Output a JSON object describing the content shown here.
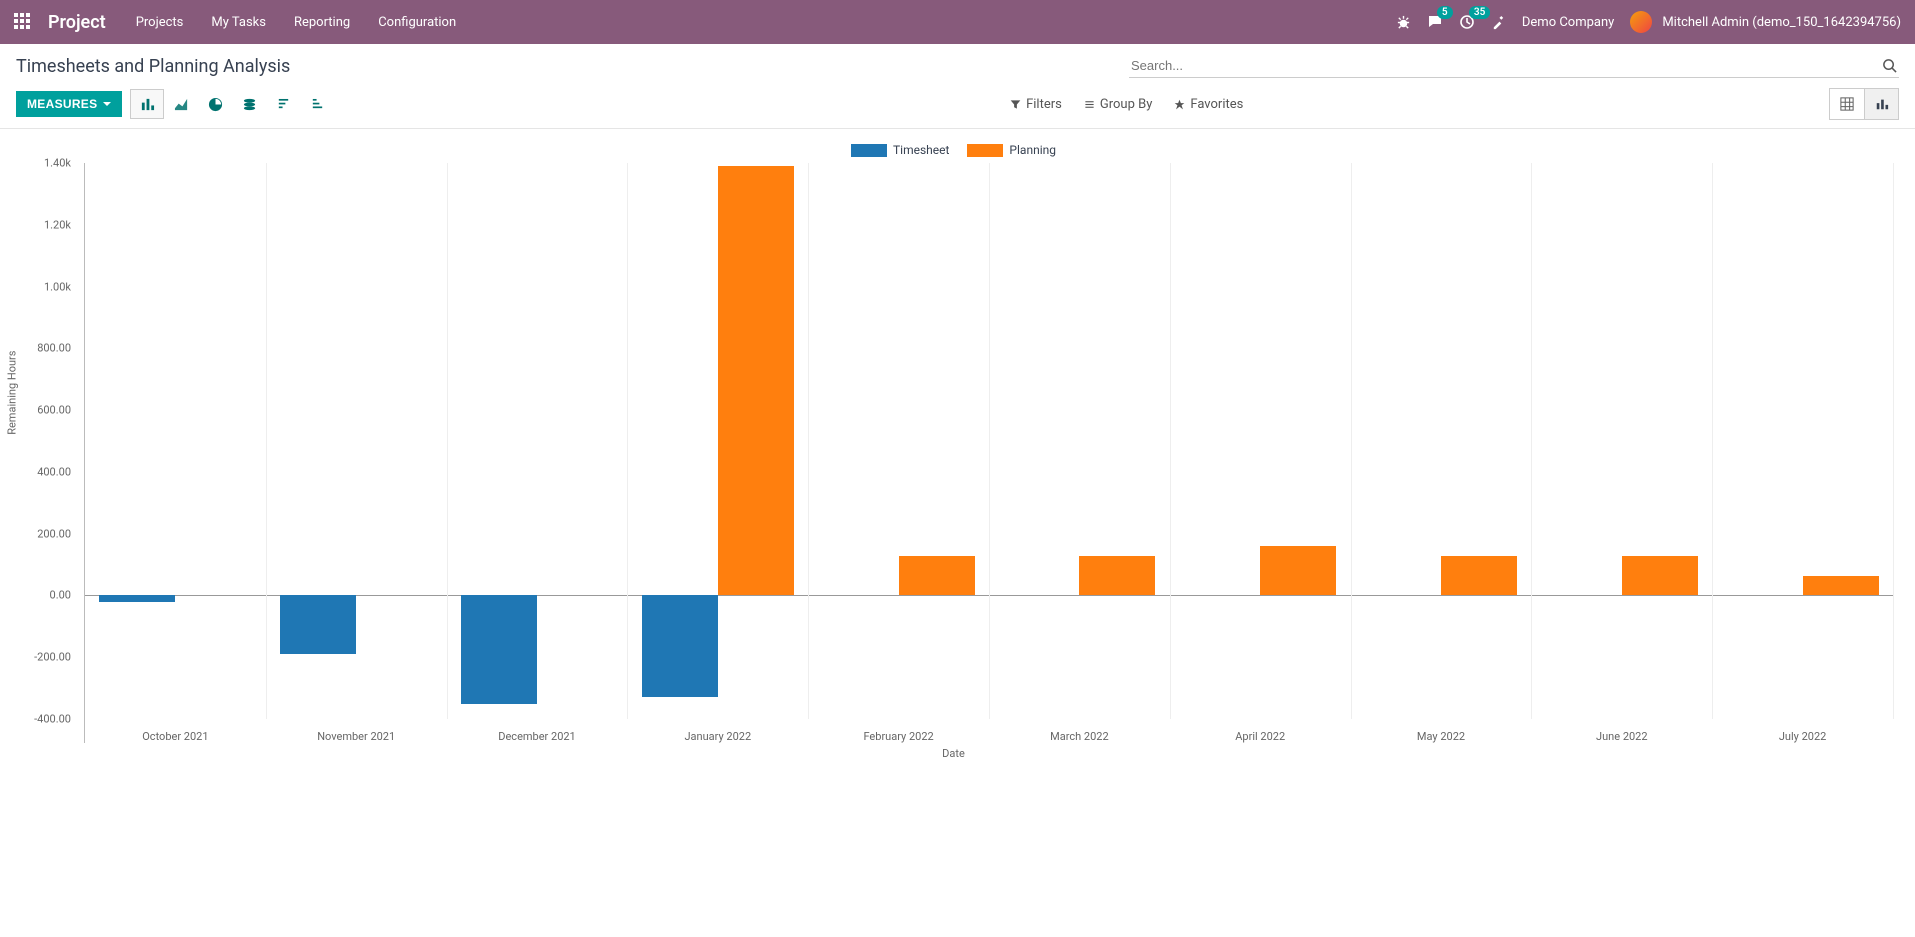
{
  "brand": "Project",
  "nav": {
    "items": [
      "Projects",
      "My Tasks",
      "Reporting",
      "Configuration"
    ]
  },
  "topbar": {
    "msg_badge": "5",
    "clock_badge": "35",
    "company": "Demo Company",
    "user": "Mitchell Admin (demo_150_1642394756)"
  },
  "breadcrumb": "Timesheets and Planning Analysis",
  "search": {
    "placeholder": "Search..."
  },
  "buttons": {
    "measures": "MEASURES"
  },
  "search_opts": {
    "filters": "Filters",
    "groupby": "Group By",
    "favorites": "Favorites"
  },
  "chart_data": {
    "type": "bar",
    "title": "",
    "xlabel": "Date",
    "ylabel": "Remaining Hours",
    "ylim": [
      -400,
      1400
    ],
    "yticks": [
      "-400.00",
      "-200.00",
      "0.00",
      "200.00",
      "400.00",
      "600.00",
      "800.00",
      "1.00k",
      "1.20k",
      "1.40k"
    ],
    "categories": [
      "October 2021",
      "November 2021",
      "December 2021",
      "January 2022",
      "February 2022",
      "March 2022",
      "April 2022",
      "May 2022",
      "June 2022",
      "July 2022"
    ],
    "series": [
      {
        "name": "Timesheet",
        "color": "#1f77b4",
        "values": [
          -20,
          -190,
          -350,
          -330,
          0,
          0,
          0,
          0,
          0,
          0
        ]
      },
      {
        "name": "Planning",
        "color": "#ff7f0e",
        "values": [
          0,
          0,
          0,
          1390,
          128,
          128,
          160,
          128,
          128,
          64
        ]
      }
    ]
  }
}
